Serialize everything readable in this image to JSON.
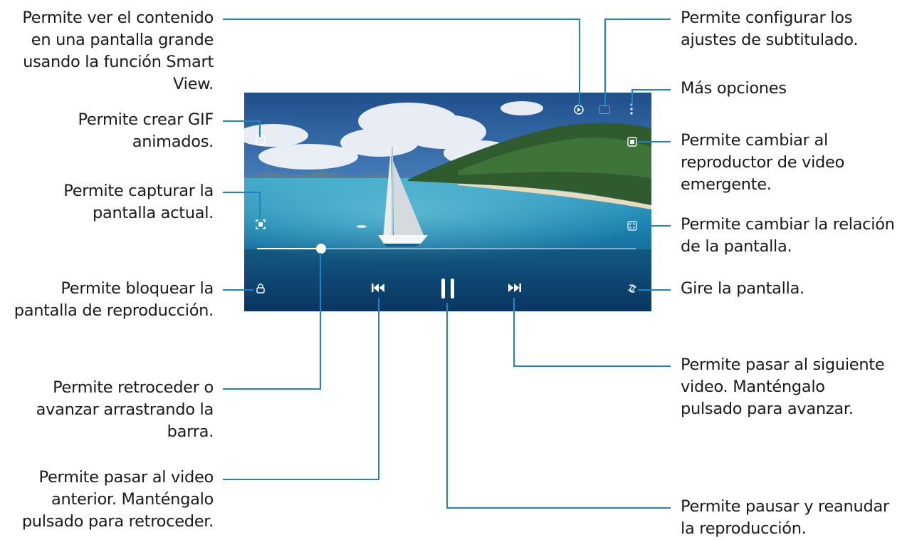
{
  "callouts": {
    "smart_view": [
      "Permite ver el contenido",
      "en una pantalla grande",
      "usando la función Smart",
      "View."
    ],
    "gif": [
      "Permite crear GIF",
      "animados."
    ],
    "capture": [
      "Permite capturar la",
      "pantalla actual."
    ],
    "lock": [
      "Permite bloquear la",
      "pantalla de reproducción."
    ],
    "seek": [
      "Permite retroceder o",
      "avanzar arrastrando la",
      "barra."
    ],
    "previous": [
      "Permite pasar al video",
      "anterior. Manténgalo",
      "pulsado para retroceder."
    ],
    "subtitles": [
      "Permite configurar los",
      "ajustes de subtitulado."
    ],
    "more": [
      "Más opciones"
    ],
    "popup": [
      "Permite cambiar al",
      "reproductor de video",
      "emergente."
    ],
    "ratio": [
      "Permite cambiar la relación",
      "de la pantalla."
    ],
    "rotate": [
      "Gire la pantalla."
    ],
    "next": [
      "Permite pasar al siguiente",
      "video. Manténgalo",
      "pulsado para avanzar."
    ],
    "pause": [
      "Permite pausar y reanudar",
      "la reproducción."
    ]
  },
  "player": {
    "progress": 0.17,
    "icons": [
      "smart-view-icon",
      "subtitles-icon",
      "more-options-icon",
      "gif-icon",
      "popup-player-icon",
      "capture-icon",
      "screen-ratio-icon",
      "lock-icon",
      "previous-icon",
      "pause-icon",
      "next-icon",
      "rotate-icon"
    ]
  },
  "colors": {
    "callout_line": "#1d84c6",
    "text": "#1a1a1a"
  }
}
